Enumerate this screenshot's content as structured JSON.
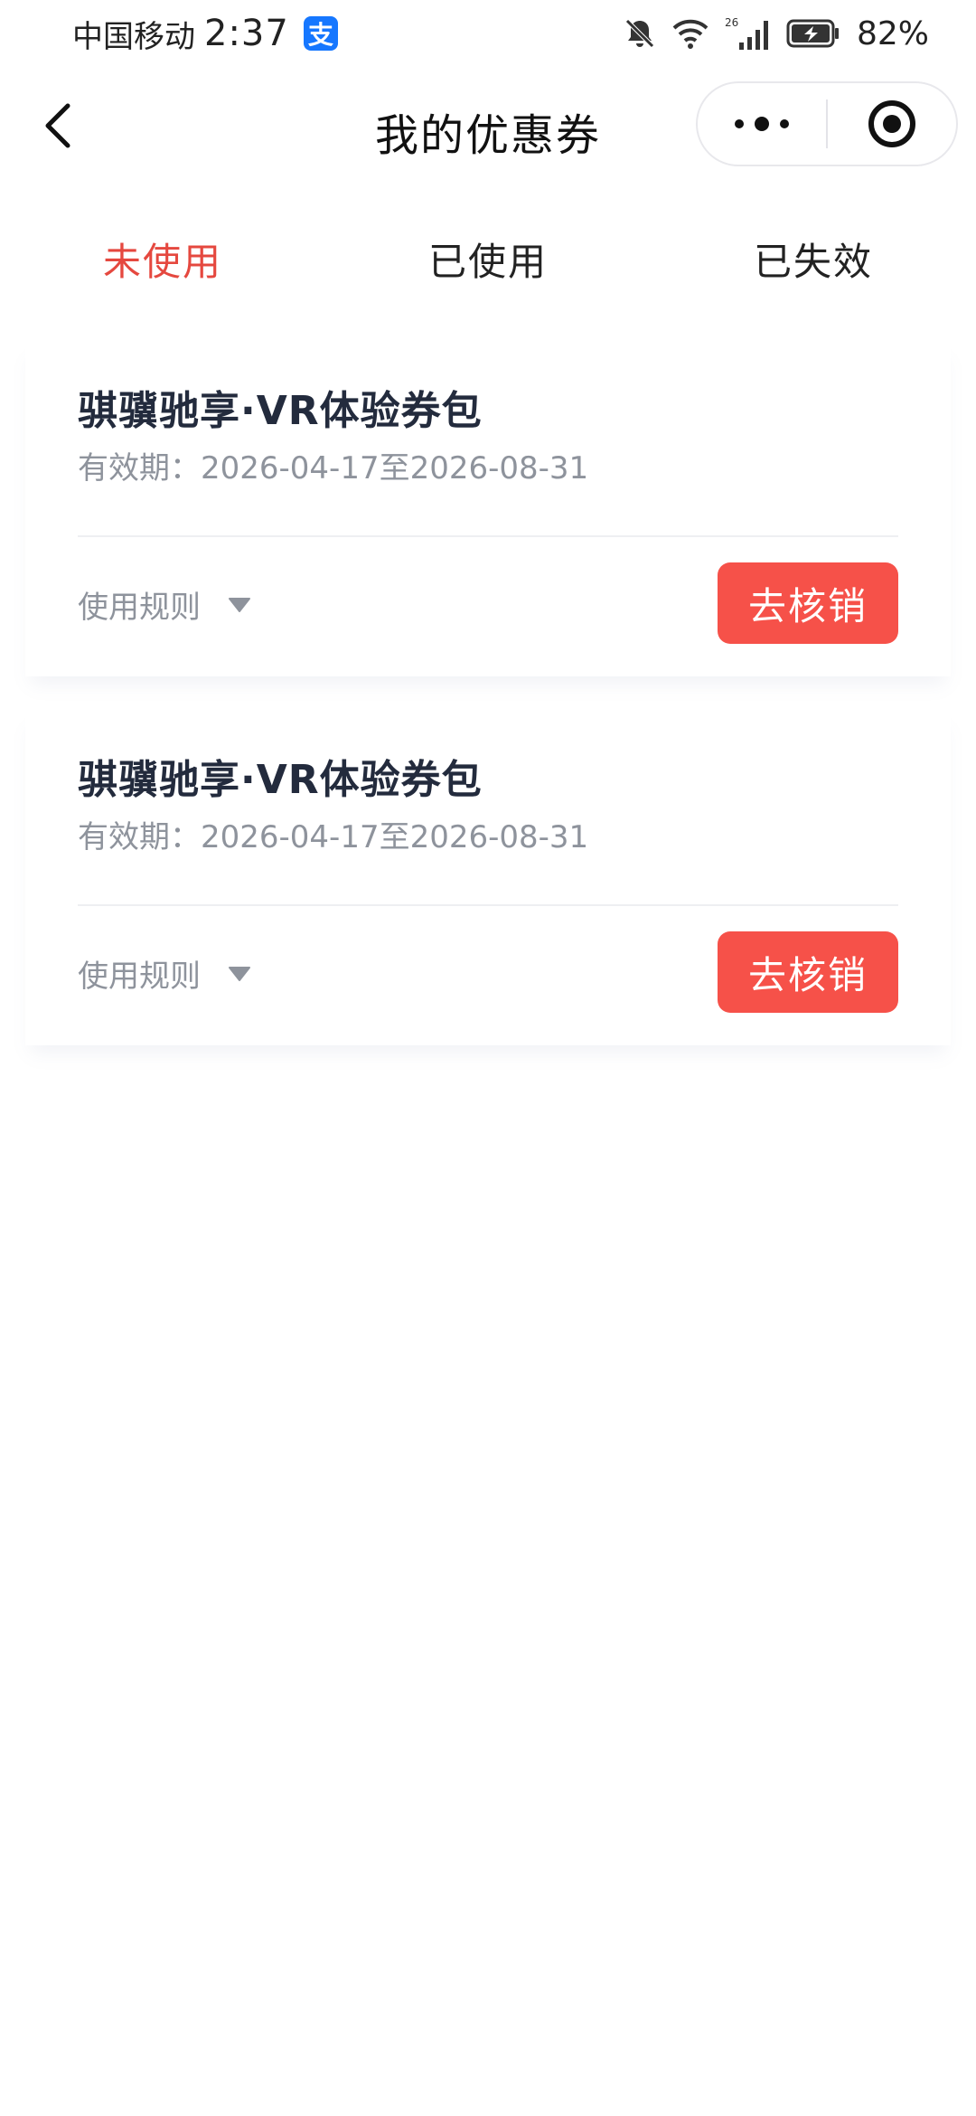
{
  "status_bar": {
    "carrier": "中国移动",
    "time": "2:37",
    "app_badge": "支",
    "network": "26",
    "battery": "82%",
    "icons": [
      "mute-bell-icon",
      "wifi-icon",
      "signal-icon",
      "battery-charging-icon"
    ]
  },
  "nav": {
    "title": "我的优惠券",
    "icons": [
      "back-chevron-icon",
      "more-dots-icon",
      "target-circle-icon"
    ]
  },
  "tabs": [
    {
      "label": "未使用",
      "active": true
    },
    {
      "label": "已使用",
      "active": false
    },
    {
      "label": "已失效",
      "active": false
    }
  ],
  "colors": {
    "accent": "#e5483f",
    "button": "#f65149",
    "title": "#232b3d",
    "muted": "#8e939c"
  },
  "coupons": [
    {
      "title": "骐骥驰享·VR体验券包",
      "validity": "有效期：2026-04-17至2026-08-31",
      "rules_label": "使用规则",
      "button_label": "去核销"
    },
    {
      "title": "骐骥驰享·VR体验券包",
      "validity": "有效期：2026-04-17至2026-08-31",
      "rules_label": "使用规则",
      "button_label": "去核销"
    }
  ]
}
